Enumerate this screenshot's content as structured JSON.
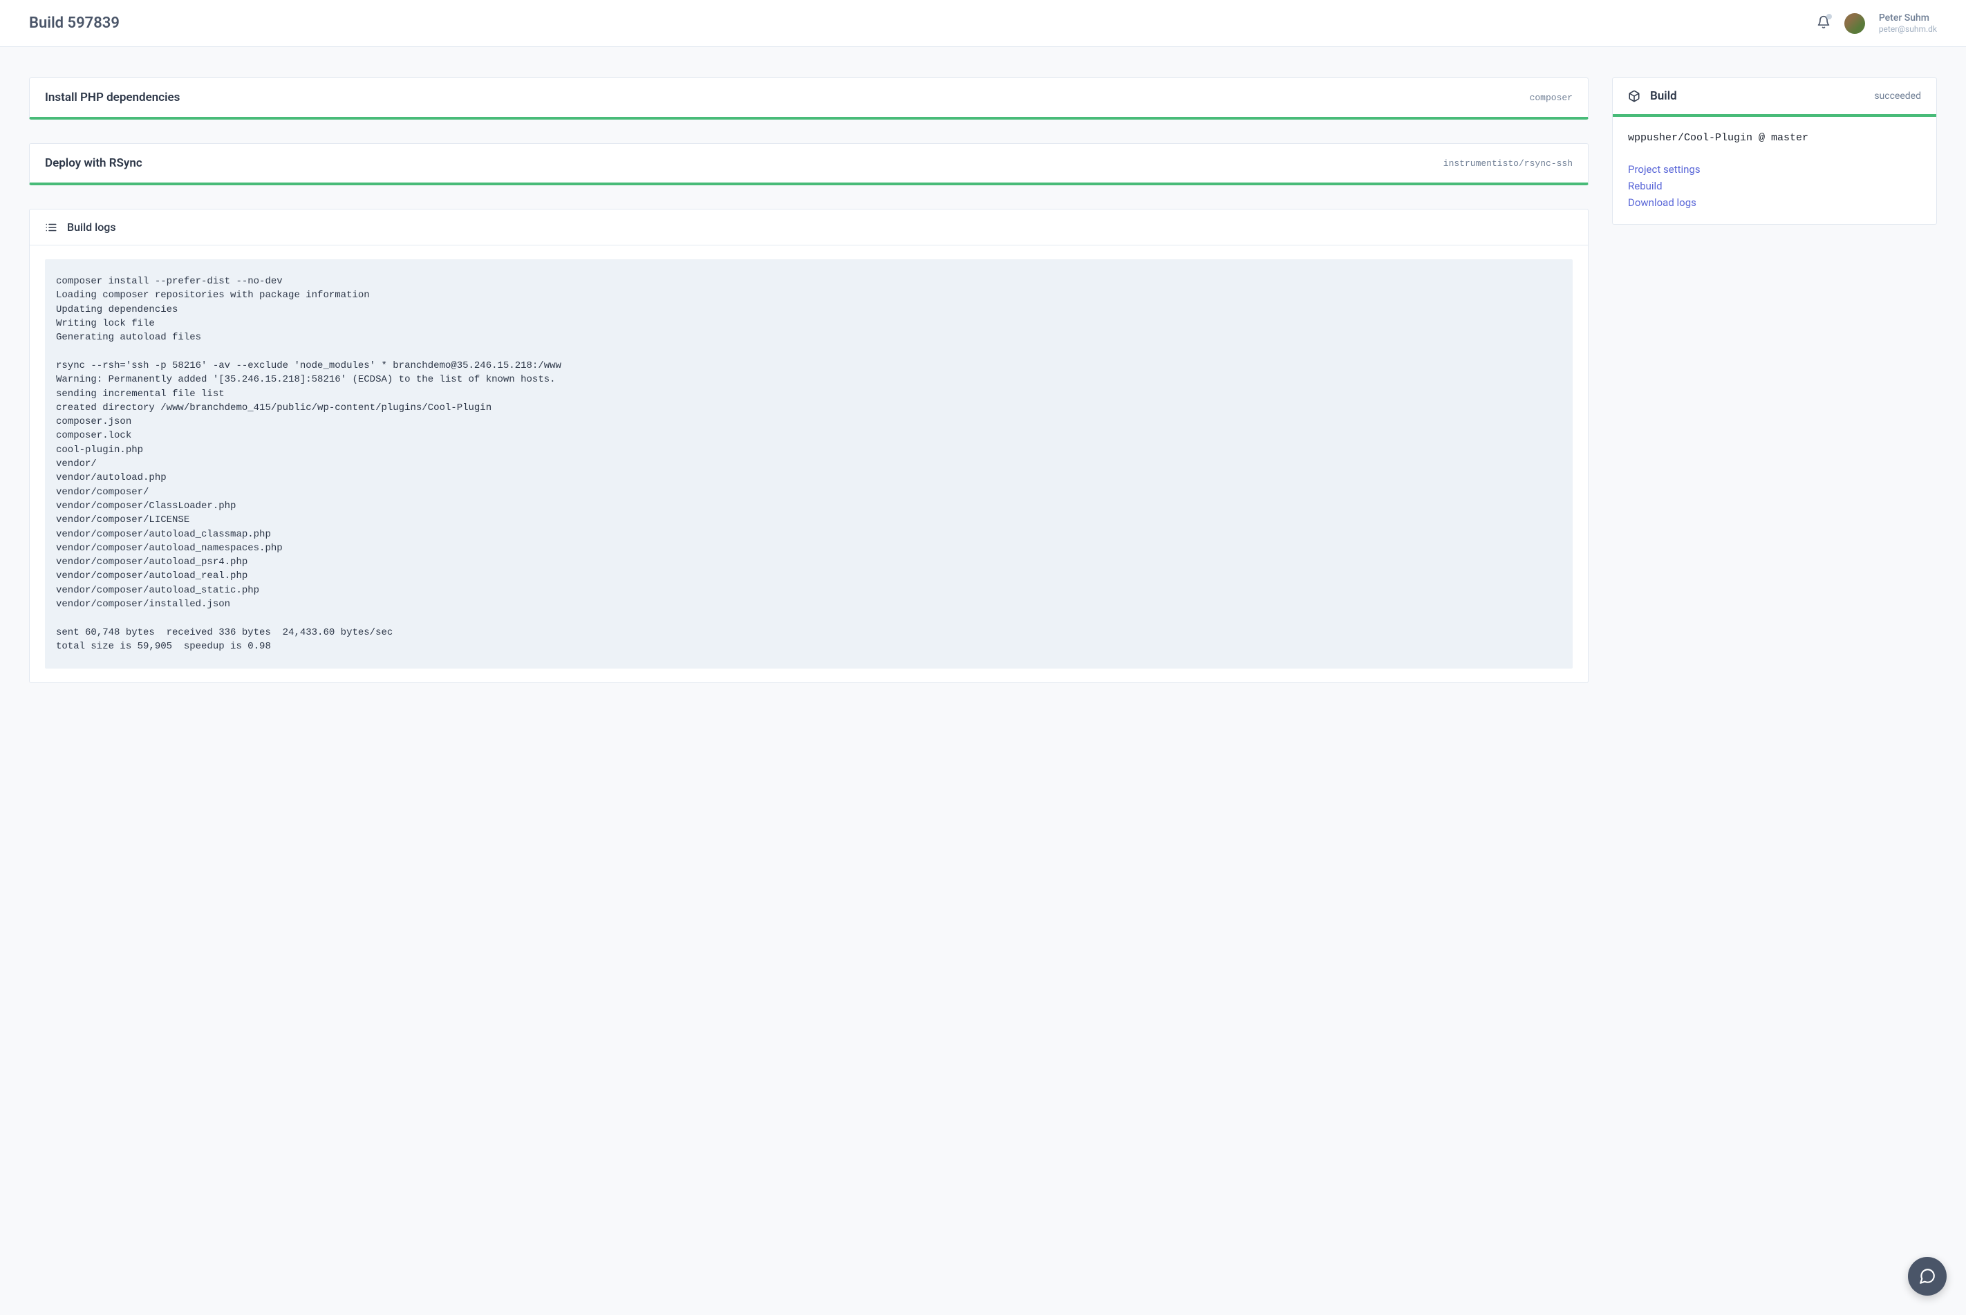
{
  "header": {
    "title": "Build 597839",
    "user": {
      "name": "Peter Suhm",
      "email": "peter@suhm.dk"
    }
  },
  "steps": [
    {
      "title": "Install PHP dependencies",
      "badge": "composer"
    },
    {
      "title": "Deploy with RSync",
      "badge": "instrumentisto/rsync-ssh"
    }
  ],
  "logs": {
    "heading": "Build logs",
    "content": "composer install --prefer-dist --no-dev\nLoading composer repositories with package information\nUpdating dependencies\nWriting lock file\nGenerating autoload files\n\nrsync --rsh='ssh -p 58216' -av --exclude 'node_modules' * branchdemo@35.246.15.218:/www\nWarning: Permanently added '[35.246.15.218]:58216' (ECDSA) to the list of known hosts.\nsending incremental file list\ncreated directory /www/branchdemo_415/public/wp-content/plugins/Cool-Plugin\ncomposer.json\ncomposer.lock\ncool-plugin.php\nvendor/\nvendor/autoload.php\nvendor/composer/\nvendor/composer/ClassLoader.php\nvendor/composer/LICENSE\nvendor/composer/autoload_classmap.php\nvendor/composer/autoload_namespaces.php\nvendor/composer/autoload_psr4.php\nvendor/composer/autoload_real.php\nvendor/composer/autoload_static.php\nvendor/composer/installed.json\n\nsent 60,748 bytes  received 336 bytes  24,433.60 bytes/sec\ntotal size is 59,905  speedup is 0.98"
  },
  "build_panel": {
    "title": "Build",
    "status": "succeeded",
    "repo": "wppusher/Cool-Plugin @ master",
    "links": [
      "Project settings",
      "Rebuild",
      "Download logs"
    ]
  }
}
